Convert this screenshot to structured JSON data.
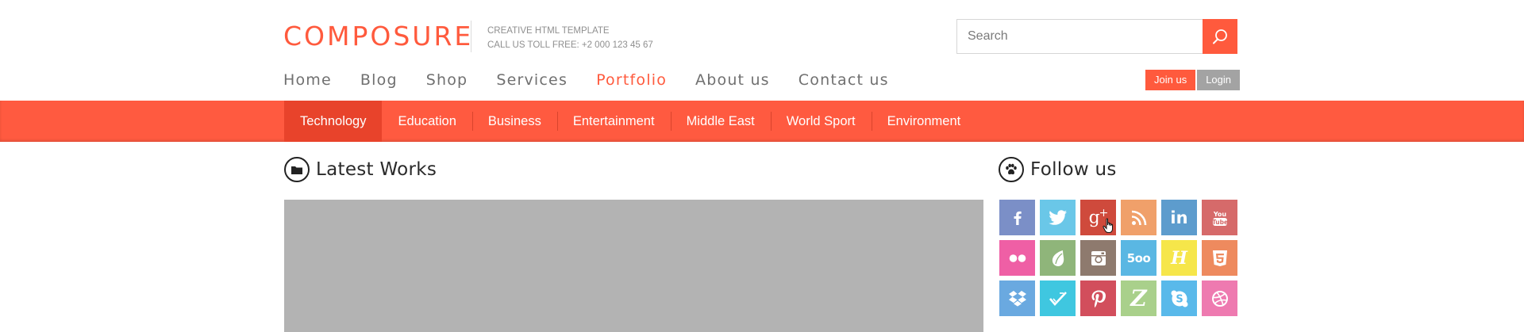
{
  "header": {
    "logo": "COMPOSURE",
    "tagline_line1": "CREATIVE HTML TEMPLATE",
    "tagline_line2": "CALL US TOLL FREE: +2 000 123 45 67",
    "search_placeholder": "Search",
    "search_icon": "search-icon",
    "join_label": "Join us",
    "login_label": "Login"
  },
  "main_nav": [
    {
      "label": "Home",
      "active": false
    },
    {
      "label": "Blog",
      "active": false
    },
    {
      "label": "Shop",
      "active": false
    },
    {
      "label": "Services",
      "active": false
    },
    {
      "label": "Portfolio",
      "active": true
    },
    {
      "label": "About us",
      "active": false
    },
    {
      "label": "Contact us",
      "active": false
    }
  ],
  "categories": [
    {
      "label": "Technology",
      "active": true
    },
    {
      "label": "Education",
      "active": false
    },
    {
      "label": "Business",
      "active": false
    },
    {
      "label": "Entertainment",
      "active": false
    },
    {
      "label": "Middle East",
      "active": false
    },
    {
      "label": "World Sport",
      "active": false
    },
    {
      "label": "Environment",
      "active": false
    }
  ],
  "latest_works": {
    "title": "Latest Works",
    "icon": "folder-icon"
  },
  "follow_us": {
    "title": "Follow us",
    "icon": "paw-icon",
    "networks": [
      {
        "name": "facebook",
        "icon": "facebook-icon",
        "color": "#7b8fc7"
      },
      {
        "name": "twitter",
        "icon": "twitter-icon",
        "color": "#6ac7e8"
      },
      {
        "name": "google-plus",
        "icon": "google-plus-icon",
        "color": "#cf4a3c"
      },
      {
        "name": "rss",
        "icon": "rss-icon",
        "color": "#f0a06a"
      },
      {
        "name": "linkedin",
        "icon": "linkedin-icon",
        "color": "#5d9ccd"
      },
      {
        "name": "youtube",
        "icon": "youtube-icon",
        "color": "#d66a6a"
      },
      {
        "name": "flickr",
        "icon": "flickr-icon",
        "color": "#ef5fa5"
      },
      {
        "name": "envato",
        "icon": "envato-icon",
        "color": "#8fb57a"
      },
      {
        "name": "instagram",
        "icon": "instagram-icon",
        "color": "#8e7a6e"
      },
      {
        "name": "500px",
        "icon": "500px-icon",
        "color": "#5ab7e3"
      },
      {
        "name": "hype",
        "icon": "hype-icon",
        "color": "#f6e64a"
      },
      {
        "name": "html5",
        "icon": "html5-icon",
        "color": "#ee8a5e"
      },
      {
        "name": "dropbox",
        "icon": "dropbox-icon",
        "color": "#6aa9e0"
      },
      {
        "name": "forrst",
        "icon": "forrst-icon",
        "color": "#3fc7e0"
      },
      {
        "name": "pinterest",
        "icon": "pinterest-icon",
        "color": "#d24e5c"
      },
      {
        "name": "zerply",
        "icon": "zerply-icon",
        "color": "#a9d08b"
      },
      {
        "name": "skype",
        "icon": "skype-icon",
        "color": "#59b9ea"
      },
      {
        "name": "dribbble",
        "icon": "dribbble-icon",
        "color": "#ee7ab0"
      }
    ]
  },
  "colors": {
    "accent": "#ff5a3d",
    "category_bar": "#ff5a40",
    "category_active": "#e8432b",
    "login_button": "#a3a3a3",
    "image_placeholder": "#b3b3b3"
  }
}
